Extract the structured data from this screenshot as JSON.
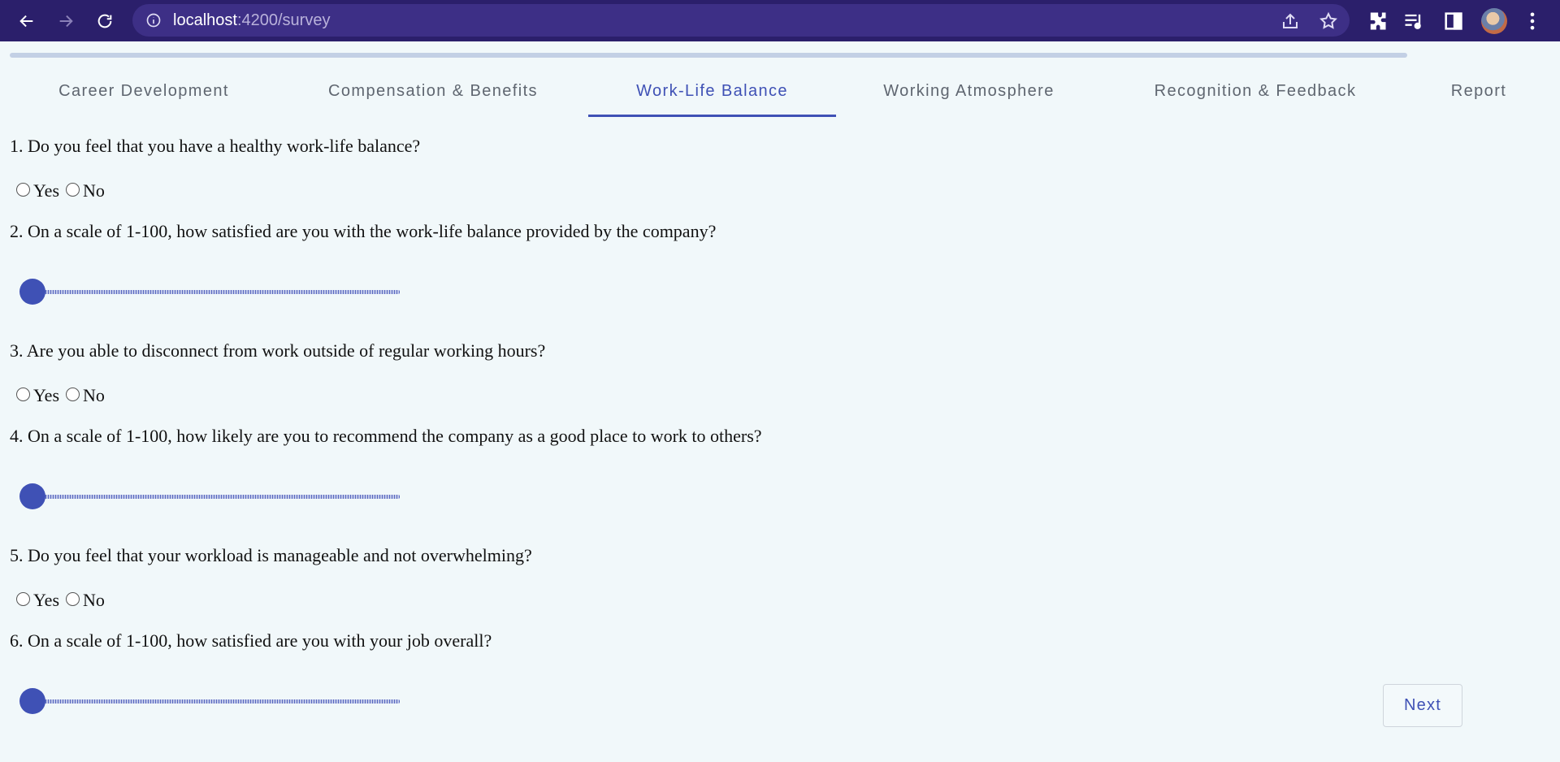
{
  "browser": {
    "url_host": "localhost",
    "url_path": ":4200/survey"
  },
  "tabs": [
    {
      "label": "Career Development",
      "active": false
    },
    {
      "label": "Compensation & Benefits",
      "active": false
    },
    {
      "label": "Work-Life Balance",
      "active": true
    },
    {
      "label": "Working Atmosphere",
      "active": false
    },
    {
      "label": "Recognition & Feedback",
      "active": false
    },
    {
      "label": "Report",
      "active": false
    }
  ],
  "questions": [
    {
      "text": "1. Do you feel that you have a healthy work-life balance?",
      "type": "yes_no",
      "options": [
        "Yes",
        "No"
      ],
      "selected": null
    },
    {
      "text": "2. On a scale of 1-100, how satisfied are you with the work-life balance provided by the company?",
      "type": "slider",
      "min": 1,
      "max": 100,
      "value": 1
    },
    {
      "text": "3. Are you able to disconnect from work outside of regular working hours?",
      "type": "yes_no",
      "options": [
        "Yes",
        "No"
      ],
      "selected": null
    },
    {
      "text": "4. On a scale of 1-100, how likely are you to recommend the company as a good place to work to others?",
      "type": "slider",
      "min": 1,
      "max": 100,
      "value": 1
    },
    {
      "text": "5. Do you feel that your workload is manageable and not overwhelming?",
      "type": "yes_no",
      "options": [
        "Yes",
        "No"
      ],
      "selected": null
    },
    {
      "text": "6. On a scale of 1-100, how satisfied are you with your job overall?",
      "type": "slider",
      "min": 1,
      "max": 100,
      "value": 1
    }
  ],
  "actions": {
    "next_label": "Next"
  },
  "colors": {
    "browser_frame": "#2b1f6b",
    "accent": "#3f51b5",
    "page_background": "#f1f8fa"
  }
}
